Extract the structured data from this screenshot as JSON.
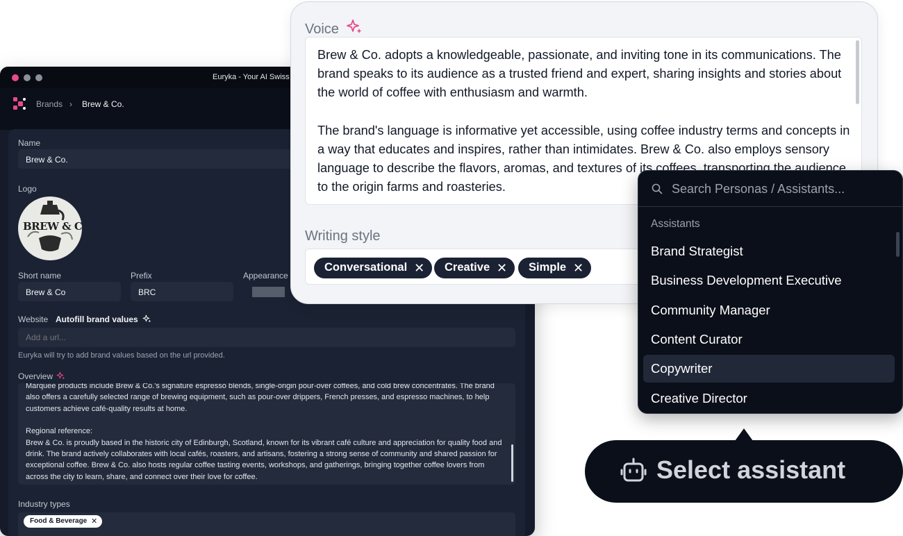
{
  "app": {
    "window_title": "Euryka - Your AI Swiss A",
    "breadcrumb": {
      "root": "Brands",
      "separator": "›",
      "current": "Brew & Co."
    },
    "form": {
      "name_label": "Name",
      "name_value": "Brew & Co.",
      "logo_label": "Logo",
      "logo_text": "BREW & CO.",
      "short_name_label": "Short name",
      "short_name_value": "Brew & Co",
      "prefix_label": "Prefix",
      "prefix_value": "BRC",
      "appearance_label": "Appearance",
      "website_label": "Website",
      "autofill_label": "Autofill brand values",
      "website_placeholder": "Add a url...",
      "website_hint": "Euryka will try to add brand values based on the url provided.",
      "overview_label": "Overview",
      "overview_paragraphs": [
        "Marquee products include Brew & Co.'s signature espresso blends, single-origin pour-over coffees, and cold brew concentrates. The brand also offers a carefully selected range of brewing equipment, such as pour-over drippers, French presses, and espresso machines, to help customers achieve café-quality results at home.",
        "Regional reference:\nBrew & Co. is proudly based in the historic city of Edinburgh, Scotland, known for its vibrant café culture and appreciation for quality food and drink. The brand actively collaborates with local cafés, roasters, and artisans, fostering a strong sense of community and shared passion for exceptional coffee. Brew & Co. also hosts regular coffee tasting events, workshops, and gatherings, bringing together coffee lovers from across the city to learn, share, and connect over their love for coffee."
      ],
      "industry_label": "Industry types",
      "industry_chips": [
        "Food & Beverage"
      ]
    }
  },
  "voice_card": {
    "voice_label": "Voice",
    "voice_paragraphs": [
      "Brew & Co. adopts a knowledgeable, passionate, and inviting tone in its communications. The brand speaks to its audience as a trusted friend and expert, sharing insights and stories about the world of coffee with enthusiasm and warmth.",
      "The brand's language is informative yet accessible, using coffee industry terms and concepts in a way that educates and inspires, rather than intimidates. Brew & Co. also employs sensory language to describe the flavors, aromas, and textures of its coffees, transporting the audience to the origin farms and roasteries."
    ],
    "writing_style_label": "Writing style",
    "chips": [
      "Conversational",
      "Creative",
      "Simple"
    ]
  },
  "dropdown": {
    "search_placeholder": "Search Personas / Assistants...",
    "section_label": "Assistants",
    "items": [
      "Brand Strategist",
      "Business Development Executive",
      "Community Manager",
      "Content Curator",
      "Copywriter",
      "Creative Director"
    ],
    "selected_index": 4
  },
  "tooltip": {
    "label": "Select assistant"
  },
  "colors": {
    "accent": "#e84a8e",
    "dark_bg": "#0b0f19",
    "panel_bg": "#1b2233"
  },
  "icons": [
    "sparkle-icon",
    "search-icon",
    "close-icon",
    "robot-icon",
    "brand-logo-icon"
  ]
}
